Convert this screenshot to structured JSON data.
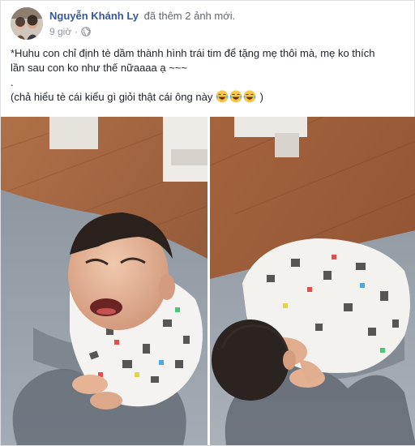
{
  "post": {
    "author": "Nguyễn Khánh Ly",
    "action": "đã thêm 2 ảnh mới.",
    "timestamp": "9 giờ",
    "separator": "·",
    "privacy_icon": "globe-icon",
    "text_lines": [
      "*Huhu con chỉ định tè dầm thành hình trái tim để tặng mẹ thôi mà, mẹ ko thích",
      "lần sau con ko như thế nữaaaa ạ ~~~",
      ".",
      "(chả hiểu tè cái kiểu gì giỏi thật cái ông này"
    ],
    "text_suffix": ")",
    "emoji_icon": "laughing-tears-emoji",
    "photos": [
      {
        "icon": "photo-crying-toddler"
      },
      {
        "icon": "photo-toddler-face-down"
      }
    ]
  }
}
